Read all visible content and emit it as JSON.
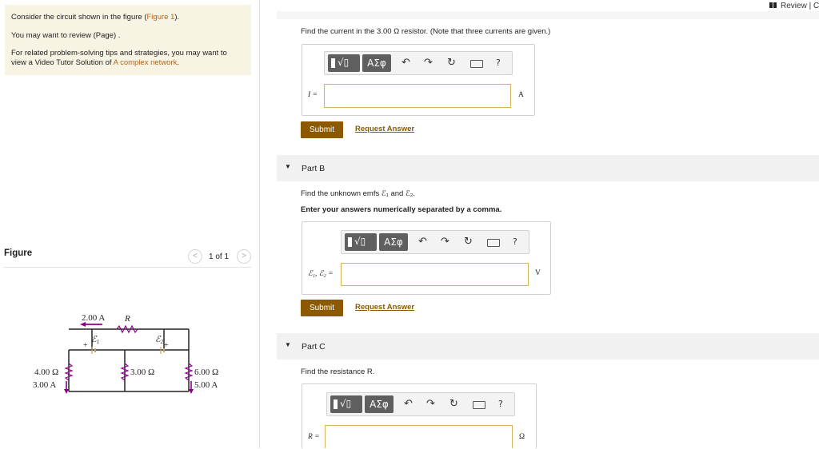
{
  "header": {
    "review_label": "Review | C"
  },
  "intro": {
    "line1_prefix": "Consider the circuit shown in the figure (",
    "line1_link": "Figure 1",
    "line1_suffix": ").",
    "line2": "You may want to review (Page) .",
    "line3": "For related problem-solving tips and strategies, you may want to",
    "line4_prefix": "view a Video Tutor Solution of ",
    "line4_link": "A complex network",
    "line4_suffix": "."
  },
  "figure": {
    "title": "Figure",
    "pager": {
      "prev": "<",
      "count": "1 of 1",
      "next": ">"
    },
    "circuit": {
      "current_top": "2.00 A",
      "resistor_top": "R",
      "emf1": "ℰ",
      "emf1_sub": "1",
      "emf2": "ℰ",
      "emf2_sub": "2",
      "plus": "+",
      "left_resistor": "4.00 Ω",
      "left_current": "3.00 A",
      "middle_resistor": "3.00 Ω",
      "right_resistor": "6.00 Ω",
      "right_current": "5.00 A"
    }
  },
  "part_a": {
    "prompt": "Find the current in the 3.00 Ω resistor. (Note that three currents are given.)",
    "input_label": "I =",
    "input_value": "",
    "unit": "A",
    "submit_label": "Submit",
    "request_label": "Request Answer"
  },
  "part_b": {
    "title": "Part B",
    "prompt": "Find the unknown emfs ℰ₁ and ℰ₂.",
    "instruction": "Enter your answers numerically separated by a comma.",
    "input_label": "ℰ₁, ℰ₂ =",
    "input_value": "",
    "unit": "V",
    "submit_label": "Submit",
    "request_label": "Request Answer"
  },
  "part_c": {
    "title": "Part C",
    "prompt": "Find the resistance R.",
    "input_label": "R =",
    "input_value": "",
    "unit": "Ω"
  },
  "toolbar": {
    "sqrt_symbol": "√▯",
    "greek_label": "ΑΣφ",
    "undo_icon": "↶",
    "redo_icon": "↷",
    "reset_icon": "↻",
    "help_label": "?"
  },
  "colors": {
    "submit_bg": "#8b5a00",
    "link": "#b5651d",
    "intro_bg": "#f7f4e3",
    "input_border": "#d6b25a",
    "arrow_current": "#8b008b",
    "resistor_wire": "#8b008b"
  }
}
